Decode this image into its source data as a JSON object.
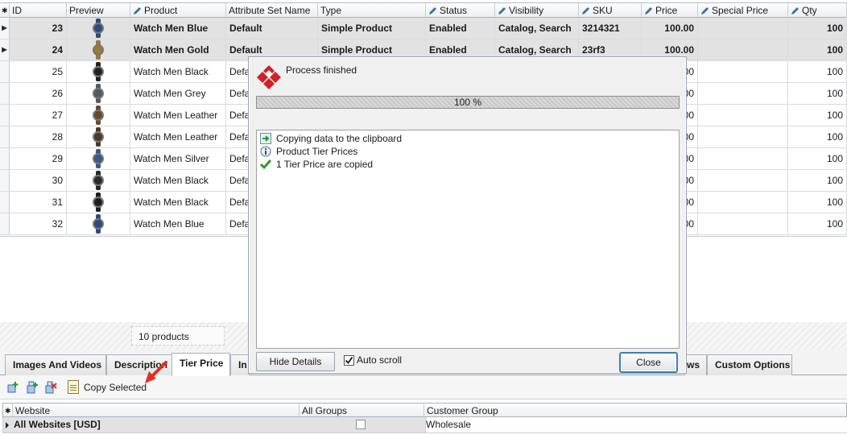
{
  "grid": {
    "columns": [
      {
        "label": "ID",
        "editable": false
      },
      {
        "label": "Preview",
        "editable": false
      },
      {
        "label": "Product",
        "editable": true
      },
      {
        "label": "Attribute Set Name",
        "editable": false
      },
      {
        "label": "Type",
        "editable": false
      },
      {
        "label": "Status",
        "editable": true
      },
      {
        "label": "Visibility",
        "editable": true
      },
      {
        "label": "SKU",
        "editable": true
      },
      {
        "label": "Price",
        "editable": true
      },
      {
        "label": "Special Price",
        "editable": true
      },
      {
        "label": "Qty",
        "editable": true
      }
    ],
    "rows": [
      {
        "id": "23",
        "product": "Watch Men Blue",
        "attribute_set": "Default",
        "type": "Simple Product",
        "status": "Enabled",
        "visibility": "Catalog, Search",
        "sku": "3214321",
        "price": "100.00",
        "special_price": "",
        "qty": "100",
        "watch_color": "#2c4a7a"
      },
      {
        "id": "24",
        "product": "Watch Men Gold",
        "attribute_set": "Default",
        "type": "Simple Product",
        "status": "Enabled",
        "visibility": "Catalog, Search",
        "sku": "23rf3",
        "price": "100.00",
        "special_price": "",
        "qty": "100",
        "watch_color": "#9a7a3a"
      },
      {
        "id": "25",
        "product": "Watch Men Black",
        "attribute_set": "Defa",
        "price": "00",
        "qty": "100",
        "watch_color": "#222222"
      },
      {
        "id": "26",
        "product": "Watch Men Grey",
        "attribute_set": "Defa",
        "price": "00",
        "qty": "100",
        "watch_color": "#555a60"
      },
      {
        "id": "27",
        "product": "Watch Men Leather",
        "attribute_set": "Defa",
        "price": "00",
        "qty": "100",
        "watch_color": "#6a4a2a"
      },
      {
        "id": "28",
        "product": "Watch Men Leather",
        "attribute_set": "Defa",
        "price": "00",
        "qty": "100",
        "watch_color": "#4a3a2a"
      },
      {
        "id": "29",
        "product": "Watch Men Silver",
        "attribute_set": "Defa",
        "price": "00",
        "qty": "100",
        "watch_color": "#3a5a8a"
      },
      {
        "id": "30",
        "product": "Watch Men Black",
        "attribute_set": "Defa",
        "price": "00",
        "qty": "100",
        "watch_color": "#2a2a2a"
      },
      {
        "id": "31",
        "product": "Watch Men Black",
        "attribute_set": "Defa",
        "price": "00",
        "qty": "100",
        "watch_color": "#1e1e1e"
      },
      {
        "id": "32",
        "product": "Watch Men Blue",
        "attribute_set": "Defa",
        "price": "00",
        "qty": "100",
        "watch_color": "#2c4a7a"
      }
    ],
    "selected_row_ids": [
      "23",
      "24"
    ],
    "product_count": "10 products"
  },
  "tabs": [
    {
      "label": "Images And Videos",
      "active": false
    },
    {
      "label": "Description",
      "active": false
    },
    {
      "label": "Tier Price",
      "active": true
    },
    {
      "label": "In",
      "active": false
    },
    {
      "label": "ws",
      "active": false
    },
    {
      "label": "Custom Options",
      "active": false
    }
  ],
  "toolbar": {
    "icons": [
      "add-icon",
      "add-child-icon",
      "delete-icon"
    ],
    "copy_selected_label": "Copy Selected"
  },
  "tier_grid": {
    "columns": [
      "Website",
      "All Groups",
      "Customer Group"
    ],
    "row": {
      "website": "All Websites [USD]",
      "all_groups_checked": false,
      "customer_group": "Wholesale"
    }
  },
  "dialog": {
    "title": "Process finished",
    "progress_percent": 100,
    "progress_label": "100 %",
    "log": [
      {
        "icon": "arrow-right-icon",
        "text": "Copying data to the clipboard"
      },
      {
        "icon": "info-icon",
        "text": "Product Tier Prices"
      },
      {
        "icon": "checkmark-icon",
        "text": "1 Tier Price are copied"
      }
    ],
    "hide_details_label": "Hide Details",
    "auto_scroll_label": "Auto scroll",
    "auto_scroll_checked": true,
    "close_label": "Close"
  },
  "colors": {
    "selected_row": "#e2e2e2",
    "logo_red": "#d0202a",
    "check_green": "#2a9a2a",
    "arrow_red": "#e03020"
  }
}
